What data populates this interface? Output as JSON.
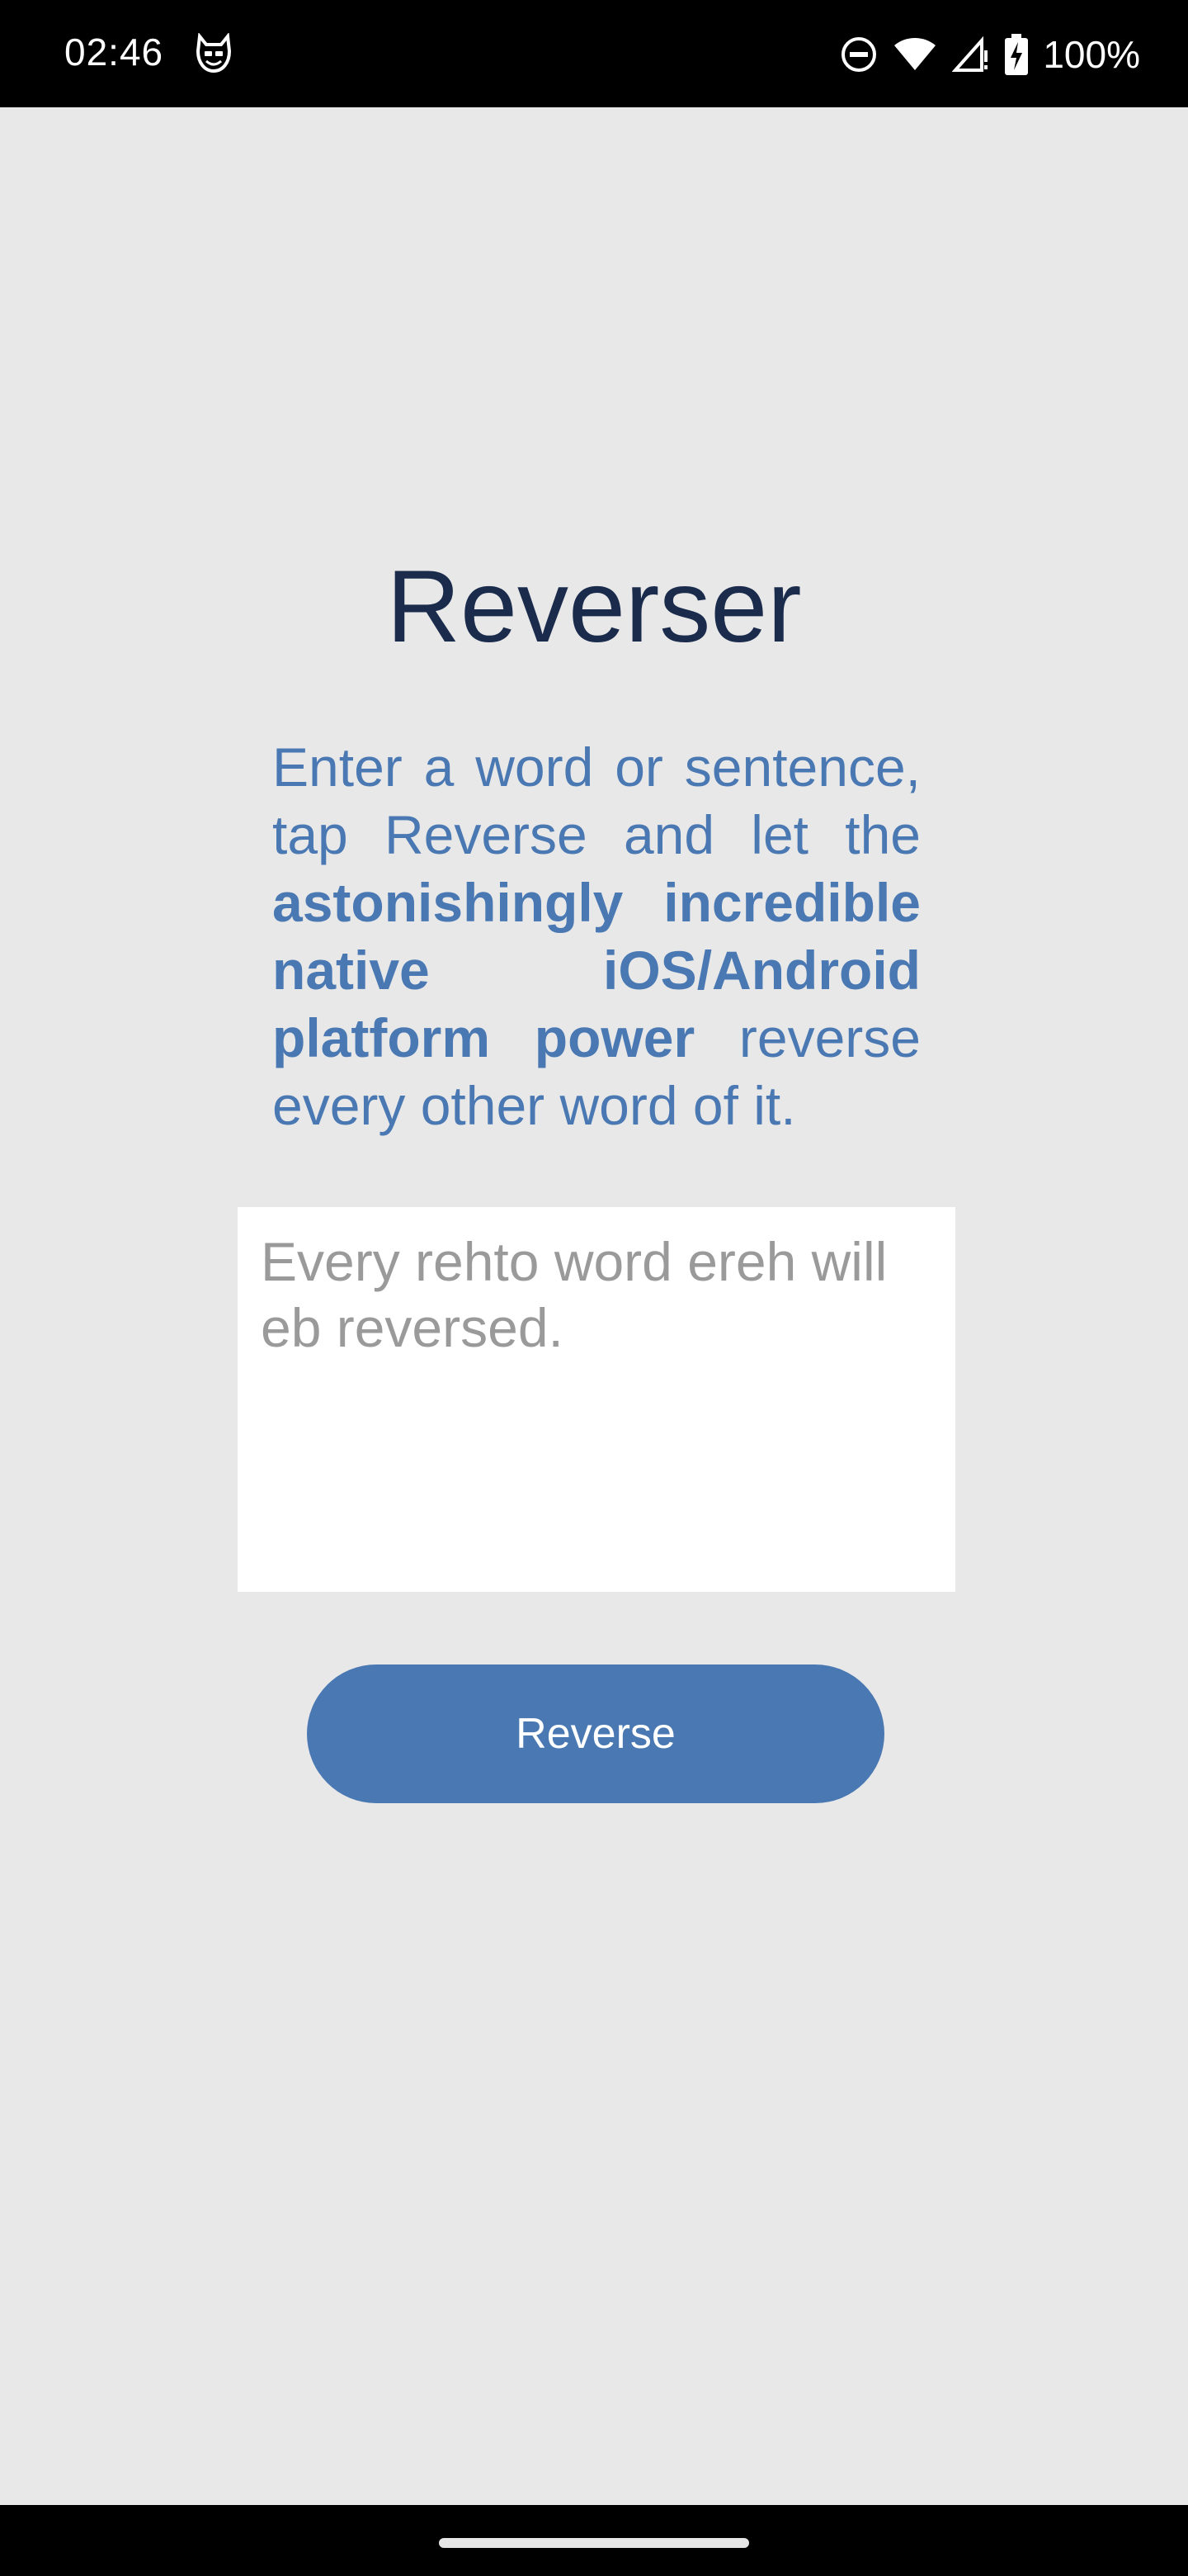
{
  "status_bar": {
    "time": "02:46",
    "battery": "100%",
    "icons": [
      "app-notification-icon",
      "do-not-disturb-icon",
      "wifi-icon",
      "cell-signal-icon",
      "battery-charging-icon"
    ]
  },
  "app": {
    "title": "Reverser",
    "description": {
      "part1": "Enter a word or sentence, tap Reverse and let the ",
      "bold": "astonishingly incredible native iOS/Android platform power",
      "part2": " reverse every other word of it."
    },
    "input": {
      "placeholder": "Every rehto word ereh will eb reversed.",
      "value": ""
    },
    "button_label": "Reverse"
  },
  "colors": {
    "background": "#e8e8e8",
    "title": "#1a2b4c",
    "accent": "#4a78b3",
    "placeholder": "#9a9a9a"
  }
}
